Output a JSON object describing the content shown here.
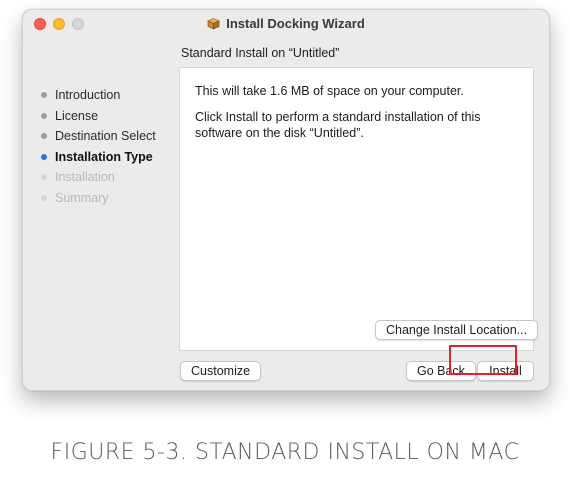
{
  "window": {
    "title": "Install Docking Wizard",
    "subtitle": "Standard Install on “Untitled”"
  },
  "sidebar": {
    "steps": [
      {
        "label": "Introduction",
        "state": "done"
      },
      {
        "label": "License",
        "state": "done"
      },
      {
        "label": "Destination Select",
        "state": "done"
      },
      {
        "label": "Installation Type",
        "state": "current"
      },
      {
        "label": "Installation",
        "state": "future"
      },
      {
        "label": "Summary",
        "state": "future"
      }
    ]
  },
  "content": {
    "line1": "This will take 1.6 MB of space on your computer.",
    "line2": "Click Install to perform a standard installation of this software on the disk “Untitled”."
  },
  "buttons": {
    "change_location": "Change Install Location...",
    "customize": "Customize",
    "go_back": "Go Back",
    "install": "Install"
  },
  "caption": "FIGURE 5-3. STANDARD INSTALL ON MAC",
  "colors": {
    "current_step_dot": "#2f6fe8",
    "highlight_box": "#e0232f",
    "close_light": "#fe5f57",
    "minimize_light": "#febc2e"
  },
  "icons": [
    "close-icon",
    "minimize-icon",
    "zoom-icon",
    "package-icon"
  ]
}
